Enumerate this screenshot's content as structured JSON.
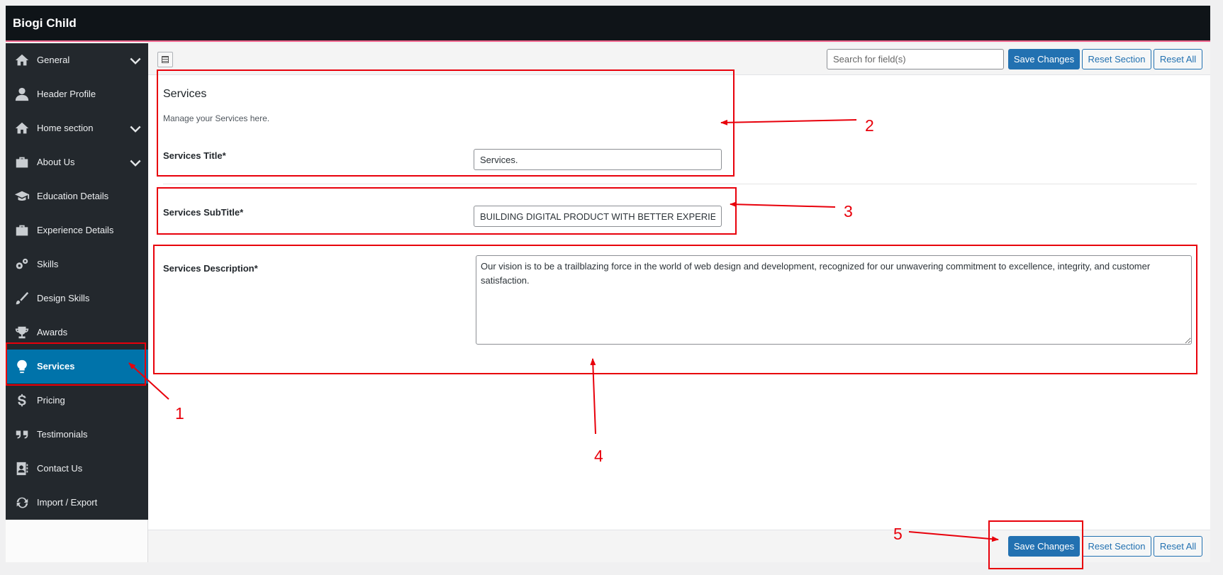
{
  "app": {
    "title": "Biogi Child"
  },
  "sidebar": {
    "items": [
      {
        "label": "General",
        "icon": "home-icon",
        "has_submenu": true
      },
      {
        "label": "Header Profile",
        "icon": "user-icon",
        "has_submenu": false
      },
      {
        "label": "Home section",
        "icon": "home-icon",
        "has_submenu": true
      },
      {
        "label": "About Us",
        "icon": "briefcase-icon",
        "has_submenu": true
      },
      {
        "label": "Education Details",
        "icon": "graduation-cap-icon",
        "has_submenu": false
      },
      {
        "label": "Experience Details",
        "icon": "briefcase-icon",
        "has_submenu": false
      },
      {
        "label": "Skills",
        "icon": "gears-icon",
        "has_submenu": false
      },
      {
        "label": "Design Skills",
        "icon": "brush-icon",
        "has_submenu": false
      },
      {
        "label": "Awards",
        "icon": "trophy-icon",
        "has_submenu": false
      },
      {
        "label": "Services",
        "icon": "lightbulb-icon",
        "has_submenu": false,
        "active": true
      },
      {
        "label": "Pricing",
        "icon": "dollar-icon",
        "has_submenu": false
      },
      {
        "label": "Testimonials",
        "icon": "quote-icon",
        "has_submenu": false
      },
      {
        "label": "Contact Us",
        "icon": "address-book-icon",
        "has_submenu": false
      },
      {
        "label": "Import / Export",
        "icon": "refresh-icon",
        "has_submenu": false
      }
    ]
  },
  "toolbar": {
    "search_placeholder": "Search for field(s)",
    "save_label": "Save Changes",
    "reset_section_label": "Reset Section",
    "reset_all_label": "Reset All"
  },
  "section": {
    "title": "Services",
    "description": "Manage your Services here."
  },
  "fields": {
    "title": {
      "label": "Services Title*",
      "value": "Services."
    },
    "subtitle": {
      "label": "Services SubTitle*",
      "value": "BUILDING DIGITAL PRODUCT WITH BETTER EXPERIEN"
    },
    "description": {
      "label": "Services Description*",
      "value": "Our vision is to be a trailblazing force in the world of web design and development, recognized for our unwavering commitment to excellence, integrity, and customer satisfaction."
    }
  },
  "footer": {
    "save_label": "Save Changes",
    "reset_section_label": "Reset Section",
    "reset_all_label": "Reset All"
  },
  "annotations": [
    "1",
    "2",
    "3",
    "4",
    "5"
  ],
  "colors": {
    "accent": "#2271b1",
    "active_menu": "#0073aa",
    "annotation": "#e8000b",
    "sidebar_bg": "#23282d"
  }
}
